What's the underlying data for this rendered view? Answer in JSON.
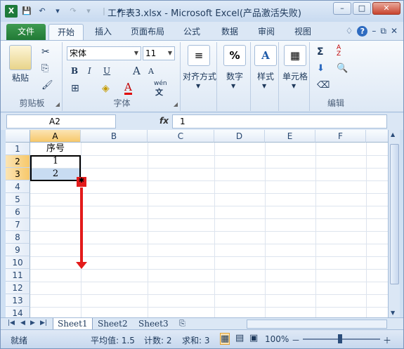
{
  "titlebar": {
    "title": "工作表3.xlsx - Microsoft Excel(产品激活失败)",
    "app_icon": "X",
    "qat": [
      "💾",
      "↶",
      "▾",
      "↷",
      "▾",
      "|",
      "▾"
    ],
    "min": "–",
    "max": "□",
    "close": "✕"
  },
  "tabs": {
    "file": "文件",
    "items": [
      "开始",
      "插入",
      "页面布局",
      "公式",
      "数据",
      "审阅",
      "视图"
    ],
    "right_icons": [
      "♢",
      "?",
      "–",
      "⧉",
      "✕"
    ]
  },
  "ribbon": {
    "clipboard": {
      "paste": "粘贴",
      "label": "剪贴板"
    },
    "font": {
      "name": "宋体",
      "size": "11",
      "label": "字体",
      "bold": "B",
      "italic": "I",
      "underline": "U",
      "grow": "A",
      "shrink": "A",
      "fontcolor": "A",
      "wen": "wén",
      "wen2": "文"
    },
    "align": {
      "label": "对齐方式"
    },
    "number": {
      "label": "数字",
      "icon": "%"
    },
    "styles": {
      "label": "样式",
      "icon": "A"
    },
    "cells": {
      "label": "单元格"
    },
    "edit": {
      "label": "编辑",
      "sigma": "Σ",
      "sort": "A Z"
    }
  },
  "formula_bar": {
    "namebox": "A2",
    "fx": "fx",
    "value": "1"
  },
  "columns": [
    "A",
    "B",
    "C",
    "D",
    "E",
    "F"
  ],
  "rows": [
    "1",
    "2",
    "3",
    "4",
    "5",
    "6",
    "7",
    "8",
    "9",
    "10",
    "11",
    "12",
    "13",
    "14"
  ],
  "cells": {
    "A1": "序号",
    "A2": "1",
    "A3": "2"
  },
  "sheets": [
    "Sheet1",
    "Sheet2",
    "Sheet3"
  ],
  "status": {
    "ready": "就绪",
    "average": "平均值: 1.5",
    "count": "计数: 2",
    "sum": "求和: 3",
    "zoom": "100%",
    "minus": "－",
    "plus": "＋"
  }
}
